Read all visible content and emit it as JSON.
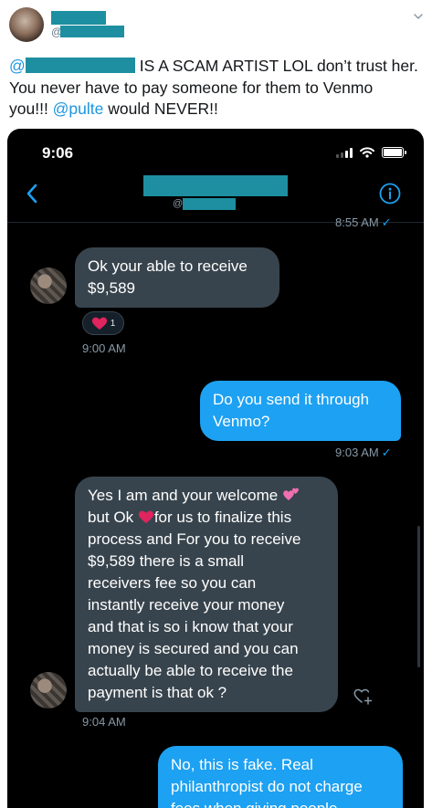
{
  "tweet": {
    "handle_prefix": "@",
    "mention_prefix": "@",
    "text_line1_rest": "IS A SCAM ARTIST LOL don’t trust her.",
    "text_line2": "You never have to pay someone for them to Venmo",
    "text_line3_start": "you!!! ",
    "mention_pulte": "@pulte",
    "text_line3_end": " would NEVER!!"
  },
  "phone": {
    "status_time": "9:06",
    "nav": {
      "handle_prefix": "@",
      "back_icon": "chevron-left-icon",
      "info_icon": "info-circle-icon"
    },
    "messages": {
      "ts_top": "8:55 AM",
      "m1": {
        "line1": "Ok your able to receive",
        "line2": "$9,589"
      },
      "reaction_count": "1",
      "ts_m1": "9:00 AM",
      "m2": {
        "line1": "Do you send it through",
        "line2": "Venmo?"
      },
      "ts_m2": "9:03 AM",
      "m3": {
        "line1": "Yes I am and your welcome",
        "line2a": "but Ok",
        "line2b": "for us to finalize this",
        "line3": "process and For you to receive",
        "line4": "$9,589 there is a small",
        "line5": "receivers fee so you can",
        "line6": "instantly receive your money",
        "line7": "and that is so i know that your",
        "line8": "money is secured and you can",
        "line9": "actually be able to receive the",
        "line10": "payment is that ok ?"
      },
      "ts_m3": "9:04 AM",
      "m4": {
        "line1": "No, this is fake. Real",
        "line2": "philanthropist do not charge",
        "line3": "fees when giving people"
      }
    }
  },
  "colors": {
    "twitter_blue": "#1da1f2",
    "received_bubble": "#38444d",
    "redaction": "#1d8fa0",
    "dm_background": "#000000"
  }
}
